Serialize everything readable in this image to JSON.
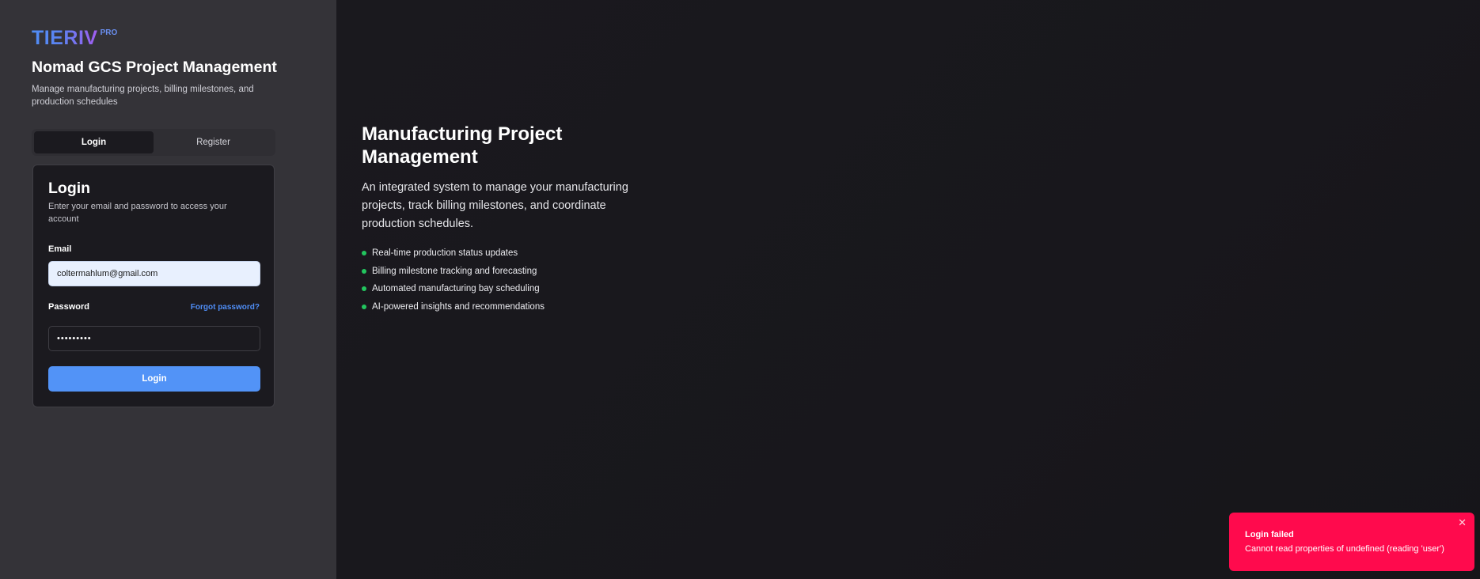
{
  "brand": {
    "name": "TIERIV",
    "badge": "PRO"
  },
  "app": {
    "title": "Nomad GCS Project Management",
    "subtitle": "Manage manufacturing projects, billing milestones, and production schedules"
  },
  "tabs": [
    {
      "label": "Login",
      "active": true
    },
    {
      "label": "Register",
      "active": false
    }
  ],
  "login_card": {
    "title": "Login",
    "description": "Enter your email and password to access your account",
    "email_label": "Email",
    "email_value": "coltermahlum@gmail.com",
    "password_label": "Password",
    "password_value": "•••••••••",
    "forgot_label": "Forgot password?",
    "submit_label": "Login"
  },
  "hero": {
    "title": "Manufacturing Project Management",
    "description": "An integrated system to manage your manufacturing projects, track billing milestones, and coordinate production schedules.",
    "features": [
      "Real-time production status updates",
      "Billing milestone tracking and forecasting",
      "Automated manufacturing bay scheduling",
      "AI-powered insights and recommendations"
    ]
  },
  "toast": {
    "title": "Login failed",
    "message": "Cannot read properties of undefined (reading 'user')",
    "close_icon": "close-icon"
  },
  "colors": {
    "accent": "#5293f7",
    "error": "#ff0a4d",
    "success_dot": "#22c55e"
  }
}
